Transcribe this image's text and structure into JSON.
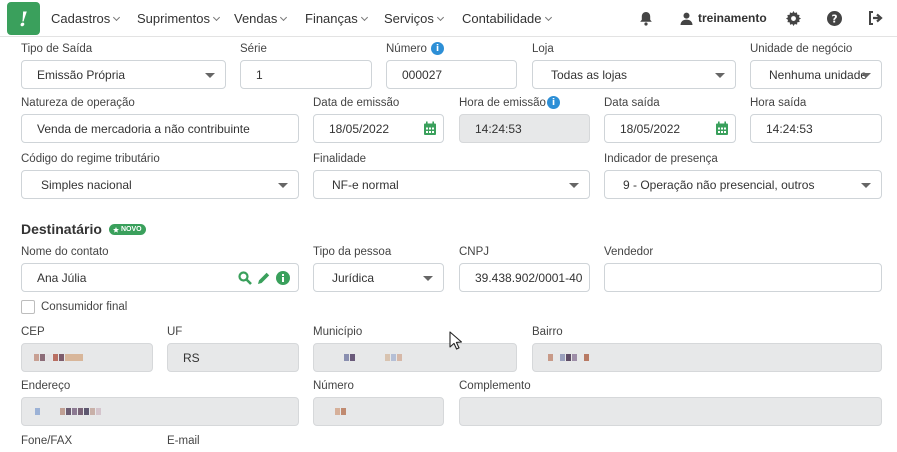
{
  "nav": {
    "menu": [
      "Cadastros",
      "Suprimentos",
      "Vendas",
      "Finanças",
      "Serviços",
      "Contabilidade"
    ],
    "user": "treinamento"
  },
  "form": {
    "tipo_saida": {
      "label": "Tipo de Saída",
      "value": "Emissão Própria"
    },
    "serie": {
      "label": "Série",
      "value": "1"
    },
    "numero": {
      "label": "Número",
      "value": "000027"
    },
    "loja": {
      "label": "Loja",
      "value": "Todas as lojas"
    },
    "unidade_negocio": {
      "label": "Unidade de negócio",
      "value": "Nenhuma unidade"
    },
    "natureza": {
      "label": "Natureza de operação",
      "value": "Venda de mercadoria a não contribuinte"
    },
    "data_emissao": {
      "label": "Data de emissão",
      "value": "18/05/2022"
    },
    "hora_emissao": {
      "label": "Hora de emissão",
      "value": "14:24:53"
    },
    "data_saida": {
      "label": "Data saída",
      "value": "18/05/2022"
    },
    "hora_saida": {
      "label": "Hora saída",
      "value": "14:24:53"
    },
    "regime": {
      "label": "Código do regime tributário",
      "value": "Simples nacional"
    },
    "finalidade": {
      "label": "Finalidade",
      "value": "NF-e normal"
    },
    "presenca": {
      "label": "Indicador de presença",
      "value": "9 - Operação não presencial, outros"
    }
  },
  "destinatario": {
    "title": "Destinatário",
    "badge": "NOVO",
    "nome": {
      "label": "Nome do contato",
      "value": "Ana Júlia"
    },
    "tipo_pessoa": {
      "label": "Tipo da pessoa",
      "value": "Jurídica"
    },
    "cnpj": {
      "label": "CNPJ",
      "value": "39.438.902/0001-40"
    },
    "vendedor": {
      "label": "Vendedor",
      "value": ""
    },
    "consumidor_final": {
      "label": "Consumidor final",
      "checked": false
    },
    "cep": {
      "label": "CEP"
    },
    "uf": {
      "label": "UF",
      "value": "RS"
    },
    "municipio": {
      "label": "Município"
    },
    "bairro": {
      "label": "Bairro"
    },
    "endereco": {
      "label": "Endereço"
    },
    "numero": {
      "label": "Número"
    },
    "complemento": {
      "label": "Complemento",
      "value": ""
    },
    "fone": {
      "label": "Fone/FAX"
    },
    "email": {
      "label": "E-mail"
    }
  },
  "colors": {
    "brand": "#3aa05c",
    "info": "#2d8fd6",
    "disabled": "#e7e8e9"
  }
}
